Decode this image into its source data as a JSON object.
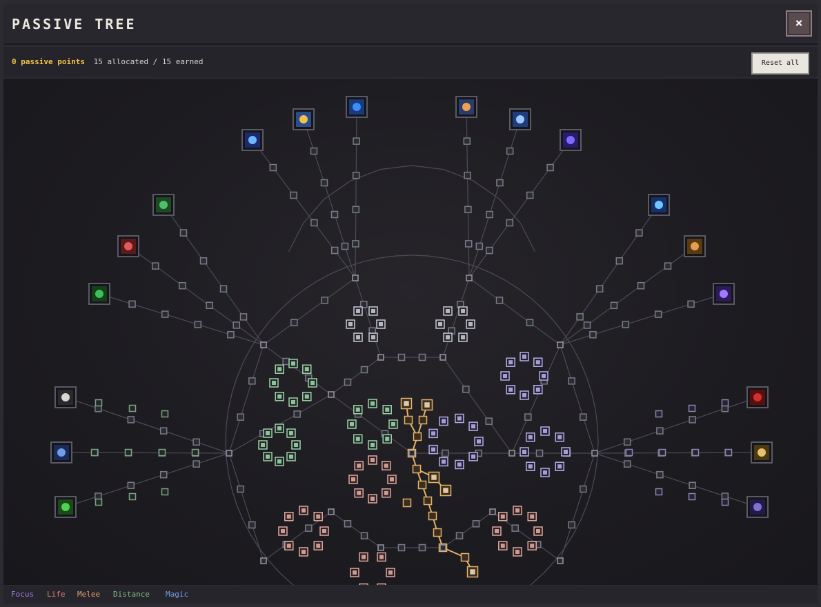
{
  "header": {
    "title": "PASSIVE TREE",
    "close_label": "×"
  },
  "stats": {
    "passive_points": "0 passive points",
    "allocated": "15 allocated / 15 earned",
    "reset_label": "Reset all"
  },
  "legend": [
    {
      "label": "Focus",
      "color": "#a07be0"
    },
    {
      "label": "Life",
      "color": "#e08070"
    },
    {
      "label": "Melee",
      "color": "#e3a070"
    },
    {
      "label": "Distance",
      "color": "#7cc089"
    },
    {
      "label": "Magic",
      "color": "#6f9de8"
    }
  ],
  "colors": {
    "path_allocated": "#e6b366",
    "node_border": "#6e6c78",
    "line": "#4d4b56"
  },
  "keystone_icons": [
    "blue-orb-icon",
    "golden-idol-icon",
    "compass-orb-icon",
    "shield-icon",
    "blue-flame-icon",
    "sparkle-orb-icon",
    "green-dragon-icon",
    "spiral-scroll-icon",
    "frost-ladder-icon",
    "golden-ring-icon",
    "green-serpent-icon",
    "purple-blade-icon",
    "eagle-icon",
    "crimson-rune-icon",
    "blue-dagger-icon",
    "golden-hammer-icon",
    "green-cross-icon",
    "dark-portal-icon"
  ]
}
